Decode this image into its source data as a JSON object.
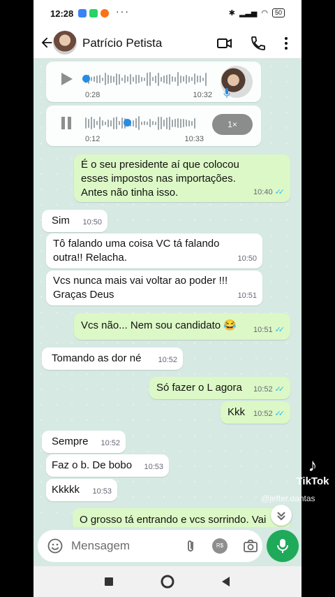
{
  "status_bar": {
    "time": "12:28",
    "battery": "50"
  },
  "header": {
    "contact_name": "Patrício Petista"
  },
  "voice_messages": [
    {
      "duration": "0:28",
      "time": "10:32",
      "playing": false,
      "progress": 0.0
    },
    {
      "duration": "0:12",
      "time": "10:33",
      "playing": true,
      "progress": 0.37,
      "speed": "1×"
    }
  ],
  "messages": [
    {
      "dir": "out",
      "text": "É o seu presidente aí que colocou esses impostos nas importações. Antes não tinha isso.",
      "time": "10:40",
      "read": true
    },
    {
      "dir": "in",
      "text": "Sim",
      "time": "10:50"
    },
    {
      "dir": "in",
      "text": "Tô falando uma coisa VC tá falando outra!! Relacha.",
      "time": "10:50"
    },
    {
      "dir": "in",
      "text": "Vcs nunca mais vai voltar ao poder !!! Graças Deus",
      "time": "10:51"
    },
    {
      "dir": "out",
      "text": "Vcs não... Nem sou candidato 😂",
      "time": "10:51",
      "read": true
    },
    {
      "dir": "in",
      "text": "Tomando as dor né",
      "time": "10:52"
    },
    {
      "dir": "out",
      "text": "Só fazer o L agora",
      "time": "10:52",
      "read": true
    },
    {
      "dir": "out",
      "text": "Kkk",
      "time": "10:52",
      "read": true
    },
    {
      "dir": "in",
      "text": "Sempre",
      "time": "10:52"
    },
    {
      "dir": "in",
      "text": "Faz o b. De bobo",
      "time": "10:53"
    },
    {
      "dir": "in",
      "text": "Kkkkk",
      "time": "10:53"
    },
    {
      "dir": "out",
      "text": "O grosso tá entrando e vcs sorrindo. Vai"
    }
  ],
  "input": {
    "placeholder": "Mensagem",
    "pay_label": "R$"
  },
  "overlay": {
    "brand": "TikTok",
    "handle": "@jefter.dantas"
  },
  "colors": {
    "outgoing": "#dcf8c6",
    "incoming": "#ffffff",
    "accent": "#1faa59",
    "read_ticks": "#34b7f1"
  },
  "icons": [
    "back-arrow-icon",
    "video-call-icon",
    "phone-icon",
    "more-icon",
    "play-icon",
    "pause-icon",
    "mic-icon",
    "emoji-icon",
    "attach-icon",
    "camera-icon",
    "chevron-down-icon"
  ]
}
